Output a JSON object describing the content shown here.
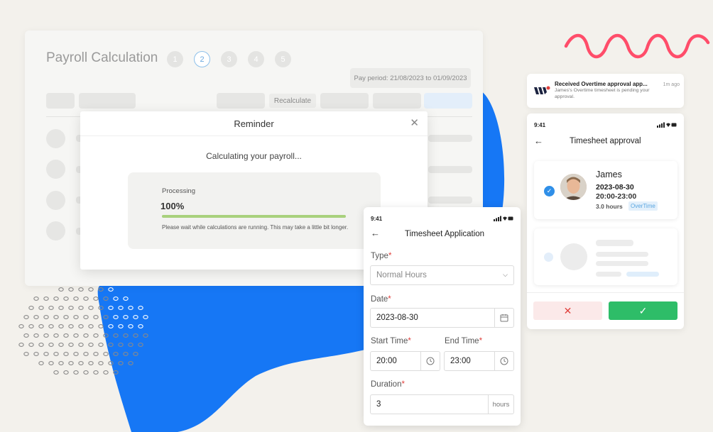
{
  "colors": {
    "blob": "#1677f5",
    "squiggle": "#ff4d6a",
    "accent": "#2f8fe8",
    "success": "#2ebd68",
    "danger": "#e0403c",
    "progress": "#a8d17c"
  },
  "payroll": {
    "title": "Payroll Calculation",
    "steps": [
      "1",
      "2",
      "3",
      "4",
      "5"
    ],
    "active_step": "2",
    "pay_period": "Pay period: 21/08/2023 to 01/09/2023",
    "recalculate_label": "Recalculate"
  },
  "reminder": {
    "title": "Reminder",
    "close_icon": "close-icon",
    "message": "Calculating your payroll...",
    "processing_label": "Processing",
    "progress_text": "100%",
    "progress_value": 1.0,
    "note": "Please wait while calculations are running. This may take a little bit longer."
  },
  "notification": {
    "title": "Received Overtime approval app...",
    "time": "1m ago",
    "body": "James's Overtime timesheet is pending your approval."
  },
  "approval": {
    "status_time": "9:41",
    "title": "Timesheet approval",
    "employee": {
      "name": "James",
      "date": "2023-08-30",
      "time_range": "20:00-23:00",
      "hours": "3.0 hours",
      "badge": "OverTime"
    },
    "reject_icon": "x-icon",
    "approve_icon": "check-icon"
  },
  "application": {
    "status_time": "9:41",
    "title": "Timesheet Application",
    "type_label": "Type",
    "type_value": "Normal Hours",
    "date_label": "Date",
    "date_value": "2023-08-30",
    "start_label": "Start Time",
    "start_value": "20:00",
    "end_label": "End Time",
    "end_value": "23:00",
    "duration_label": "Duration",
    "duration_value": "3",
    "duration_unit": "hours",
    "required_mark": "*"
  }
}
